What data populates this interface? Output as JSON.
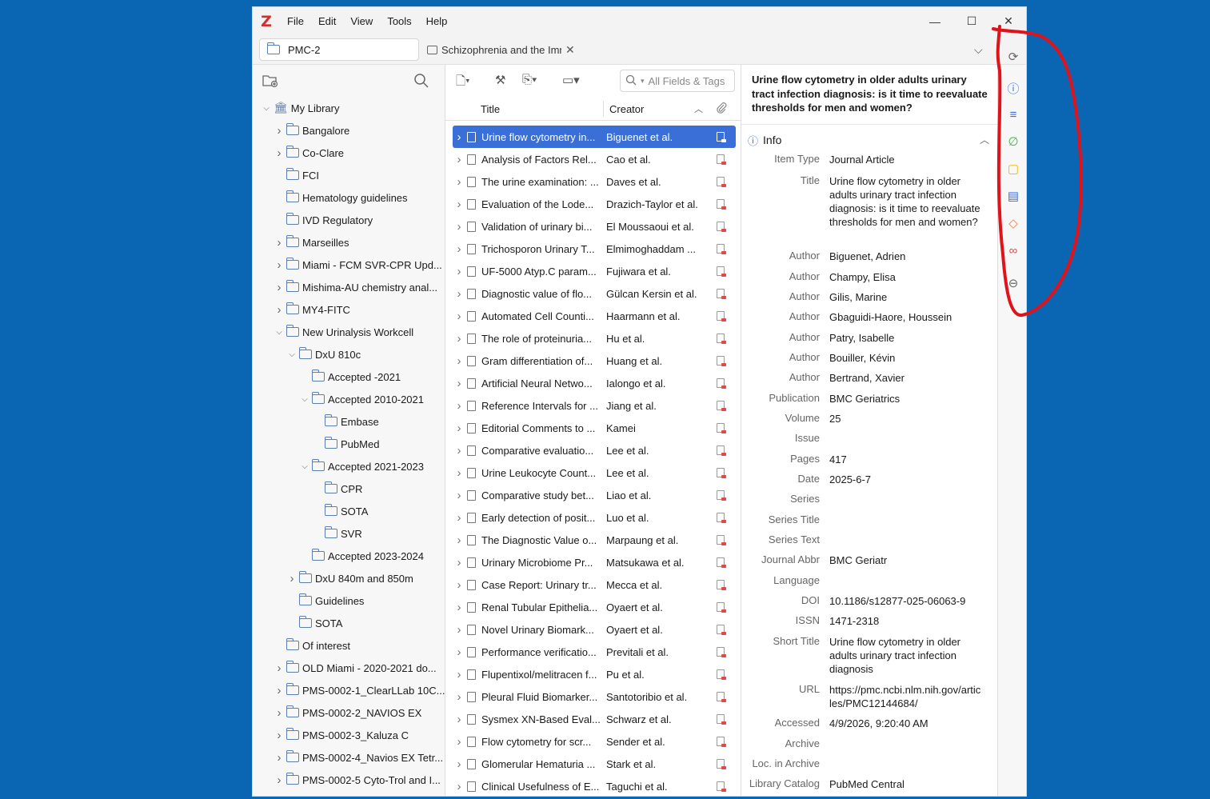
{
  "menu": [
    "File",
    "Edit",
    "View",
    "Tools",
    "Help"
  ],
  "app_logo": "Z",
  "window_controls": {
    "minimize": "—",
    "maximize": "☐",
    "close": "✕"
  },
  "tabs": {
    "library_tab": "PMC-2",
    "doc_tab": "Schizophrenia and the Immune System"
  },
  "collections": [
    {
      "label": "My Library",
      "depth": 0,
      "twisty": "open",
      "icon": "library-icon"
    },
    {
      "label": "Bangalore",
      "depth": 1,
      "twisty": "closed"
    },
    {
      "label": "Co-Clare",
      "depth": 1,
      "twisty": "closed"
    },
    {
      "label": "FCI",
      "depth": 1,
      "twisty": "none"
    },
    {
      "label": "Hematology guidelines",
      "depth": 1,
      "twisty": "none"
    },
    {
      "label": "IVD Regulatory",
      "depth": 1,
      "twisty": "none"
    },
    {
      "label": "Marseilles",
      "depth": 1,
      "twisty": "closed"
    },
    {
      "label": "Miami - FCM SVR-CPR Upd...",
      "depth": 1,
      "twisty": "closed"
    },
    {
      "label": "Mishima-AU chemistry anal...",
      "depth": 1,
      "twisty": "closed"
    },
    {
      "label": "MY4-FITC",
      "depth": 1,
      "twisty": "closed"
    },
    {
      "label": "New Urinalysis Workcell",
      "depth": 1,
      "twisty": "open"
    },
    {
      "label": "DxU 810c",
      "depth": 2,
      "twisty": "open"
    },
    {
      "label": "Accepted -2021",
      "depth": 3,
      "twisty": "none"
    },
    {
      "label": "Accepted 2010-2021",
      "depth": 3,
      "twisty": "open"
    },
    {
      "label": "Embase",
      "depth": 4,
      "twisty": "none"
    },
    {
      "label": "PubMed",
      "depth": 4,
      "twisty": "none"
    },
    {
      "label": "Accepted 2021-2023",
      "depth": 3,
      "twisty": "open"
    },
    {
      "label": "CPR",
      "depth": 4,
      "twisty": "none"
    },
    {
      "label": "SOTA",
      "depth": 4,
      "twisty": "none"
    },
    {
      "label": "SVR",
      "depth": 4,
      "twisty": "none"
    },
    {
      "label": "Accepted 2023-2024",
      "depth": 3,
      "twisty": "none"
    },
    {
      "label": "DxU 840m and 850m",
      "depth": 2,
      "twisty": "closed"
    },
    {
      "label": "Guidelines",
      "depth": 2,
      "twisty": "none"
    },
    {
      "label": "SOTA",
      "depth": 2,
      "twisty": "none"
    },
    {
      "label": "Of interest",
      "depth": 1,
      "twisty": "none"
    },
    {
      "label": "OLD Miami - 2020-2021 do...",
      "depth": 1,
      "twisty": "closed"
    },
    {
      "label": "PMS-0002-1_ClearLLab 10C...",
      "depth": 1,
      "twisty": "closed"
    },
    {
      "label": "PMS-0002-2_NAVIOS EX",
      "depth": 1,
      "twisty": "closed"
    },
    {
      "label": "PMS-0002-3_Kaluza C",
      "depth": 1,
      "twisty": "closed"
    },
    {
      "label": "PMS-0002-4_Navios EX Tetr...",
      "depth": 1,
      "twisty": "closed"
    },
    {
      "label": "PMS-0002-5 Cyto-Trol and I...",
      "depth": 1,
      "twisty": "closed"
    }
  ],
  "items_toolbar": {
    "search_placeholder": "All Fields & Tags"
  },
  "columns": {
    "title": "Title",
    "creator": "Creator"
  },
  "items": [
    {
      "title": "Urine flow cytometry in...",
      "creator": "Biguenet et al.",
      "selected": true
    },
    {
      "title": "Analysis of Factors Rel...",
      "creator": "Cao et al."
    },
    {
      "title": "The urine examination: ...",
      "creator": "Daves et al."
    },
    {
      "title": "Evaluation of the Lode...",
      "creator": "Drazich-Taylor et al."
    },
    {
      "title": "Validation of urinary bi...",
      "creator": "El Moussaoui et al."
    },
    {
      "title": "Trichosporon Urinary T...",
      "creator": "Elmimoghaddam ..."
    },
    {
      "title": "UF-5000 Atyp.C param...",
      "creator": "Fujiwara et al."
    },
    {
      "title": "Diagnostic value of flo...",
      "creator": "Gülcan Kersin et al."
    },
    {
      "title": "Automated Cell Counti...",
      "creator": "Haarmann et al."
    },
    {
      "title": "The role of proteinuria...",
      "creator": "Hu et al."
    },
    {
      "title": "Gram differentiation of...",
      "creator": "Huang et al."
    },
    {
      "title": "Artificial Neural Netwo...",
      "creator": "Ialongo et al."
    },
    {
      "title": "Reference Intervals for ...",
      "creator": "Jiang et al."
    },
    {
      "title": "Editorial Comments to ...",
      "creator": "Kamei"
    },
    {
      "title": "Comparative evaluatio...",
      "creator": "Lee et al."
    },
    {
      "title": "Urine Leukocyte Count...",
      "creator": "Lee et al."
    },
    {
      "title": "Comparative study bet...",
      "creator": "Liao et al."
    },
    {
      "title": "Early detection of posit...",
      "creator": "Luo et al."
    },
    {
      "title": "The Diagnostic Value o...",
      "creator": "Marpaung et al."
    },
    {
      "title": "Urinary Microbiome Pr...",
      "creator": "Matsukawa et al."
    },
    {
      "title": "Case Report: Urinary tr...",
      "creator": "Mecca et al."
    },
    {
      "title": "Renal Tubular Epithelia...",
      "creator": "Oyaert et al."
    },
    {
      "title": "Novel Urinary Biomark...",
      "creator": "Oyaert et al."
    },
    {
      "title": "Performance verificatio...",
      "creator": "Previtali et al."
    },
    {
      "title": "Flupentixol/melitracen f...",
      "creator": "Pu et al."
    },
    {
      "title": "Pleural Fluid Biomarker...",
      "creator": "Santotoribio et al."
    },
    {
      "title": "Sysmex XN-Based Eval...",
      "creator": "Schwarz et al."
    },
    {
      "title": "Flow cytometry for scr...",
      "creator": "Sender et al."
    },
    {
      "title": "Glomerular Hematuria ...",
      "creator": "Stark et al."
    },
    {
      "title": "Clinical Usefulness of E...",
      "creator": "Taguchi et al."
    }
  ],
  "info": {
    "heading": "Urine flow cytometry in older adults urinary tract infection diagnosis: is it time to reevaluate thresholds for men and women?",
    "section": "Info",
    "fields": [
      {
        "label": "Item Type",
        "value": "Journal Article"
      },
      {
        "label": "Title",
        "value": "Urine flow cytometry in older adults urinary tract infection diagnosis: is it time to reevaluate thresholds for men and women?"
      },
      {
        "label": "Author",
        "value": "Biguenet, Adrien"
      },
      {
        "label": "Author",
        "value": "Champy, Elisa"
      },
      {
        "label": "Author",
        "value": "Gilis, Marine"
      },
      {
        "label": "Author",
        "value": "Gbaguidi-Haore, Houssein"
      },
      {
        "label": "Author",
        "value": "Patry, Isabelle"
      },
      {
        "label": "Author",
        "value": "Bouiller, Kévin"
      },
      {
        "label": "Author",
        "value": "Bertrand, Xavier"
      },
      {
        "label": "Publication",
        "value": "BMC Geriatrics"
      },
      {
        "label": "Volume",
        "value": "25"
      },
      {
        "label": "Issue",
        "value": ""
      },
      {
        "label": "Pages",
        "value": "417"
      },
      {
        "label": "Date",
        "value": "2025-6-7"
      },
      {
        "label": "Series",
        "value": ""
      },
      {
        "label": "Series Title",
        "value": ""
      },
      {
        "label": "Series Text",
        "value": ""
      },
      {
        "label": "Journal Abbr",
        "value": "BMC Geriatr"
      },
      {
        "label": "Language",
        "value": ""
      },
      {
        "label": "DOI",
        "value": "10.1186/s12877-025-06063-9"
      },
      {
        "label": "ISSN",
        "value": "1471-2318"
      },
      {
        "label": "Short Title",
        "value": "Urine flow cytometry in older adults urinary tract infection diagnosis"
      },
      {
        "label": "URL",
        "value": "https://pmc.ncbi.nlm.nih.gov/articles/PMC12144684/"
      },
      {
        "label": "Accessed",
        "value": "4/9/2026, 9:20:40 AM"
      },
      {
        "label": "Archive",
        "value": ""
      },
      {
        "label": "Loc. in Archive",
        "value": ""
      },
      {
        "label": "Library Catalog",
        "value": "PubMed Central"
      }
    ]
  },
  "sidenav": [
    {
      "name": "sync-icon",
      "glyph": "⟳",
      "color": "#666666"
    },
    {
      "name": "info-section-icon",
      "glyph": "ⓘ",
      "color": "#3a6fd8"
    },
    {
      "name": "abstract-section-icon",
      "glyph": "≡",
      "color": "#3a6fd8"
    },
    {
      "name": "attachments-section-icon",
      "glyph": "∅",
      "color": "#4caf50"
    },
    {
      "name": "notes-section-icon",
      "glyph": "▢",
      "color": "#f0b400"
    },
    {
      "name": "libraries-collections-icon",
      "glyph": "▤",
      "color": "#3a6fd8"
    },
    {
      "name": "tags-section-icon",
      "glyph": "◇",
      "color": "#e8804a"
    },
    {
      "name": "related-section-icon",
      "glyph": "∞",
      "color": "#e04848"
    },
    {
      "name": "locate-icon",
      "glyph": "⊖",
      "color": "#666666"
    }
  ],
  "colors": {
    "accent": "#3a6fd8",
    "annotation": "#e0131b",
    "background": "#0a66b2"
  }
}
